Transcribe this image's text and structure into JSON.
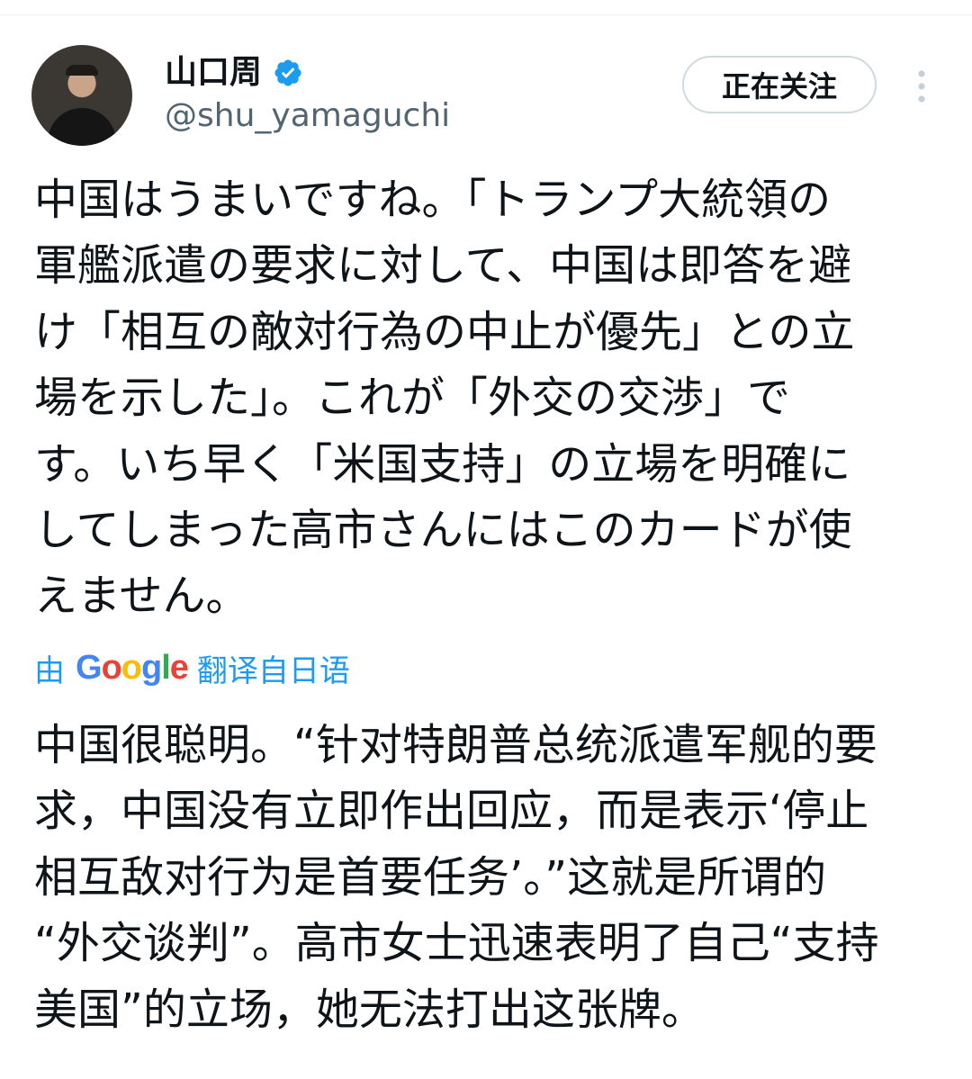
{
  "author": {
    "display_name": "山口周",
    "handle": "@shu_yamaguchi",
    "verified": true
  },
  "follow_button": {
    "label": "正在关注"
  },
  "icons": {
    "verified": "verified-badge-icon",
    "more": "more-vertical-icon"
  },
  "colors": {
    "accent": "#1d9bf0",
    "text": "#0f1419",
    "secondary": "#536471",
    "border": "#cfd9de"
  },
  "tweet": {
    "text_lines": [
      "中国はうまいですね。「トランプ大統領の",
      "軍艦派遣の要求に対して、中国は即答を避",
      "け「相互の敵対行為の中止が優先」との立",
      "場を示した」。これが「外交の交渉」で",
      "す。いち早く「米国支持」の立場を明確に",
      "してしまった高市さんにはこのカードが使",
      "えません。"
    ]
  },
  "translation": {
    "prefix": "由",
    "provider": "Google",
    "suffix": "翻译自日语",
    "text_lines": [
      "中国很聪明。“针对特朗普总统派遣军舰的要",
      "求，中国没有立即作出回应，而是表示‘停止",
      "相互敌对行为是首要任务’。”这就是所谓的",
      "“外交谈判”。高市女士迅速表明了自己“支持",
      "美国”的立场，她无法打出这张牌。"
    ]
  }
}
